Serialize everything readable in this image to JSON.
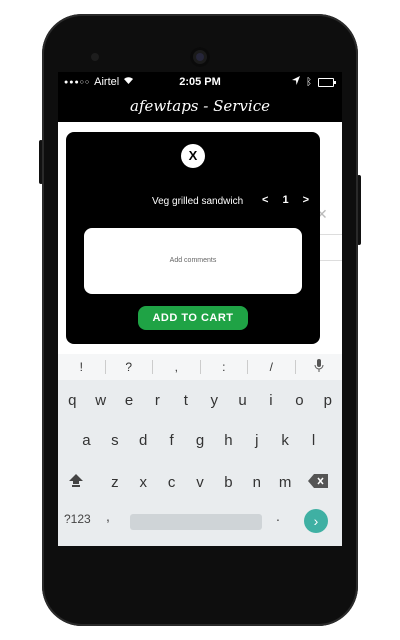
{
  "status": {
    "carrier": "Airtel",
    "time": "2:05 PM"
  },
  "app": {
    "title": "afewtaps - Service"
  },
  "modal": {
    "close_label": "X",
    "item_name": "Veg grilled sandwich",
    "qty_minus": "<",
    "qty_value": "1",
    "qty_plus": ">",
    "comments_placeholder": "Add comments",
    "add_to_cart_label": "ADD TO CART"
  },
  "keyboard": {
    "symbols": [
      "!",
      "?",
      ",",
      ":",
      "/"
    ],
    "row1": [
      "q",
      "w",
      "e",
      "r",
      "t",
      "y",
      "u",
      "i",
      "o",
      "p"
    ],
    "row2": [
      "a",
      "s",
      "d",
      "f",
      "g",
      "h",
      "j",
      "k",
      "l"
    ],
    "row3": [
      "z",
      "x",
      "c",
      "v",
      "b",
      "n",
      "m"
    ],
    "mode_label": "?123",
    "comma": ",",
    "period": "."
  },
  "colors": {
    "accent_green": "#1fa345",
    "go_teal": "#3fb0a3",
    "bar_black": "#000000"
  },
  "icons": [
    "wifi-icon",
    "location-icon",
    "bluetooth-icon",
    "battery-icon",
    "mic-icon",
    "shift-icon",
    "backspace-icon",
    "go-arrow-icon"
  ]
}
